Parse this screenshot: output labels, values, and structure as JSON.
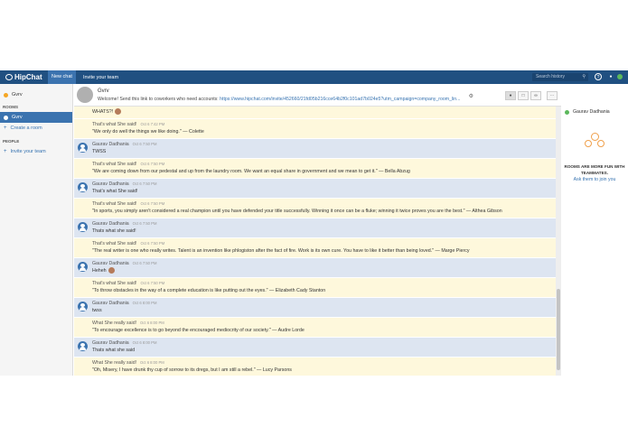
{
  "app": {
    "logo_text": "HipChat",
    "nav_newchat": "New chat",
    "nav_invite": "Invite your team",
    "search_placeholder": "Search history",
    "brand_color": "#205081"
  },
  "sidebar": {
    "top_room": "Gvrv",
    "rooms_header": "ROOMS",
    "active_room": "Gvrv",
    "create_room": "Create a room",
    "people_header": "PEOPLE",
    "invite_team": "Invite your team"
  },
  "room": {
    "name": "Gvrv",
    "topic_prefix": "Welcome! Send this link to coworkers who need accounts:",
    "topic_link": "https://www.hipchat.com/invite/452660/21fd05b216cce64b2f0c101ad7b024e5?utm_campaign=company_room_lin..."
  },
  "messages": [
    {
      "type": "bot",
      "sender": "",
      "time": "",
      "text": "WHATS?!",
      "emoji": true
    },
    {
      "type": "bot",
      "sender": "That's what She said!",
      "time": "Oct 6 7:42 PM",
      "text": "\"We only do well the things we like doing.\" — Colette"
    },
    {
      "type": "user",
      "sender": "Gaurav Dadhania",
      "time": "Oct 6 7:50 PM",
      "text": "TWSS"
    },
    {
      "type": "bot",
      "sender": "That's what She said!",
      "time": "Oct 6 7:50 PM",
      "text": "\"We are coming down from our pedestal and up from the laundry room. We want an equal share in government and we mean to get it.\" — Bella Abzug"
    },
    {
      "type": "user",
      "sender": "Gaurav Dadhania",
      "time": "Oct 6 7:50 PM",
      "text": "That's what She said!"
    },
    {
      "type": "bot",
      "sender": "That's what She said!",
      "time": "Oct 6 7:50 PM",
      "text": "\"In sports, you simply aren't considered a real champion until you have defended your title successfully. Winning it once can be a fluke; winning it twice proves you are the best.\" — Althea Gibson"
    },
    {
      "type": "user",
      "sender": "Gaurav Dadhania",
      "time": "Oct 6 7:50 PM",
      "text": "Thats what she said!"
    },
    {
      "type": "bot",
      "sender": "That's what She said!",
      "time": "Oct 6 7:50 PM",
      "text": "\"The real writer is one who really writes. Talent is an invention like phlogiston after the fact of fire. Work is its own cure. You have to like it better than being loved.\" — Marge Piercy"
    },
    {
      "type": "user",
      "sender": "Gaurav Dadhania",
      "time": "Oct 6 7:50 PM",
      "text": "Heheh",
      "emoji": true
    },
    {
      "type": "bot",
      "sender": "That's what She said!",
      "time": "Oct 6 7:50 PM",
      "text": "\"To throw obstacles in the way of a complete education is like putting out the eyes.\" — Elizabeth Cady Stanton"
    },
    {
      "type": "user",
      "sender": "Gaurav Dadhania",
      "time": "Oct 6 8:00 PM",
      "text": "twss"
    },
    {
      "type": "bot",
      "sender": "What She really said!",
      "time": "Oct 6 8:00 PM",
      "text": "\"To encourage excellence is to go beyond the encouraged mediocrity of our society.\" — Audre Lorde"
    },
    {
      "type": "user",
      "sender": "Gaurav Dadhania",
      "time": "Oct 6 8:00 PM",
      "text": "Thats what she said"
    },
    {
      "type": "bot",
      "sender": "What She really said!",
      "time": "Oct 6 8:00 PM",
      "text": "\"Oh, Misery, I have drunk thy cup of sorrow to its dregs, but I am still a rebel.\" — Lucy Parsons"
    }
  ],
  "rightpanel": {
    "user": "Gaurav Dadhania",
    "cta_line1": "ROOMS ARE MORE FUN WITH",
    "cta_line2": "TEAMMATES.",
    "ask_link": "Ask them to join you"
  }
}
